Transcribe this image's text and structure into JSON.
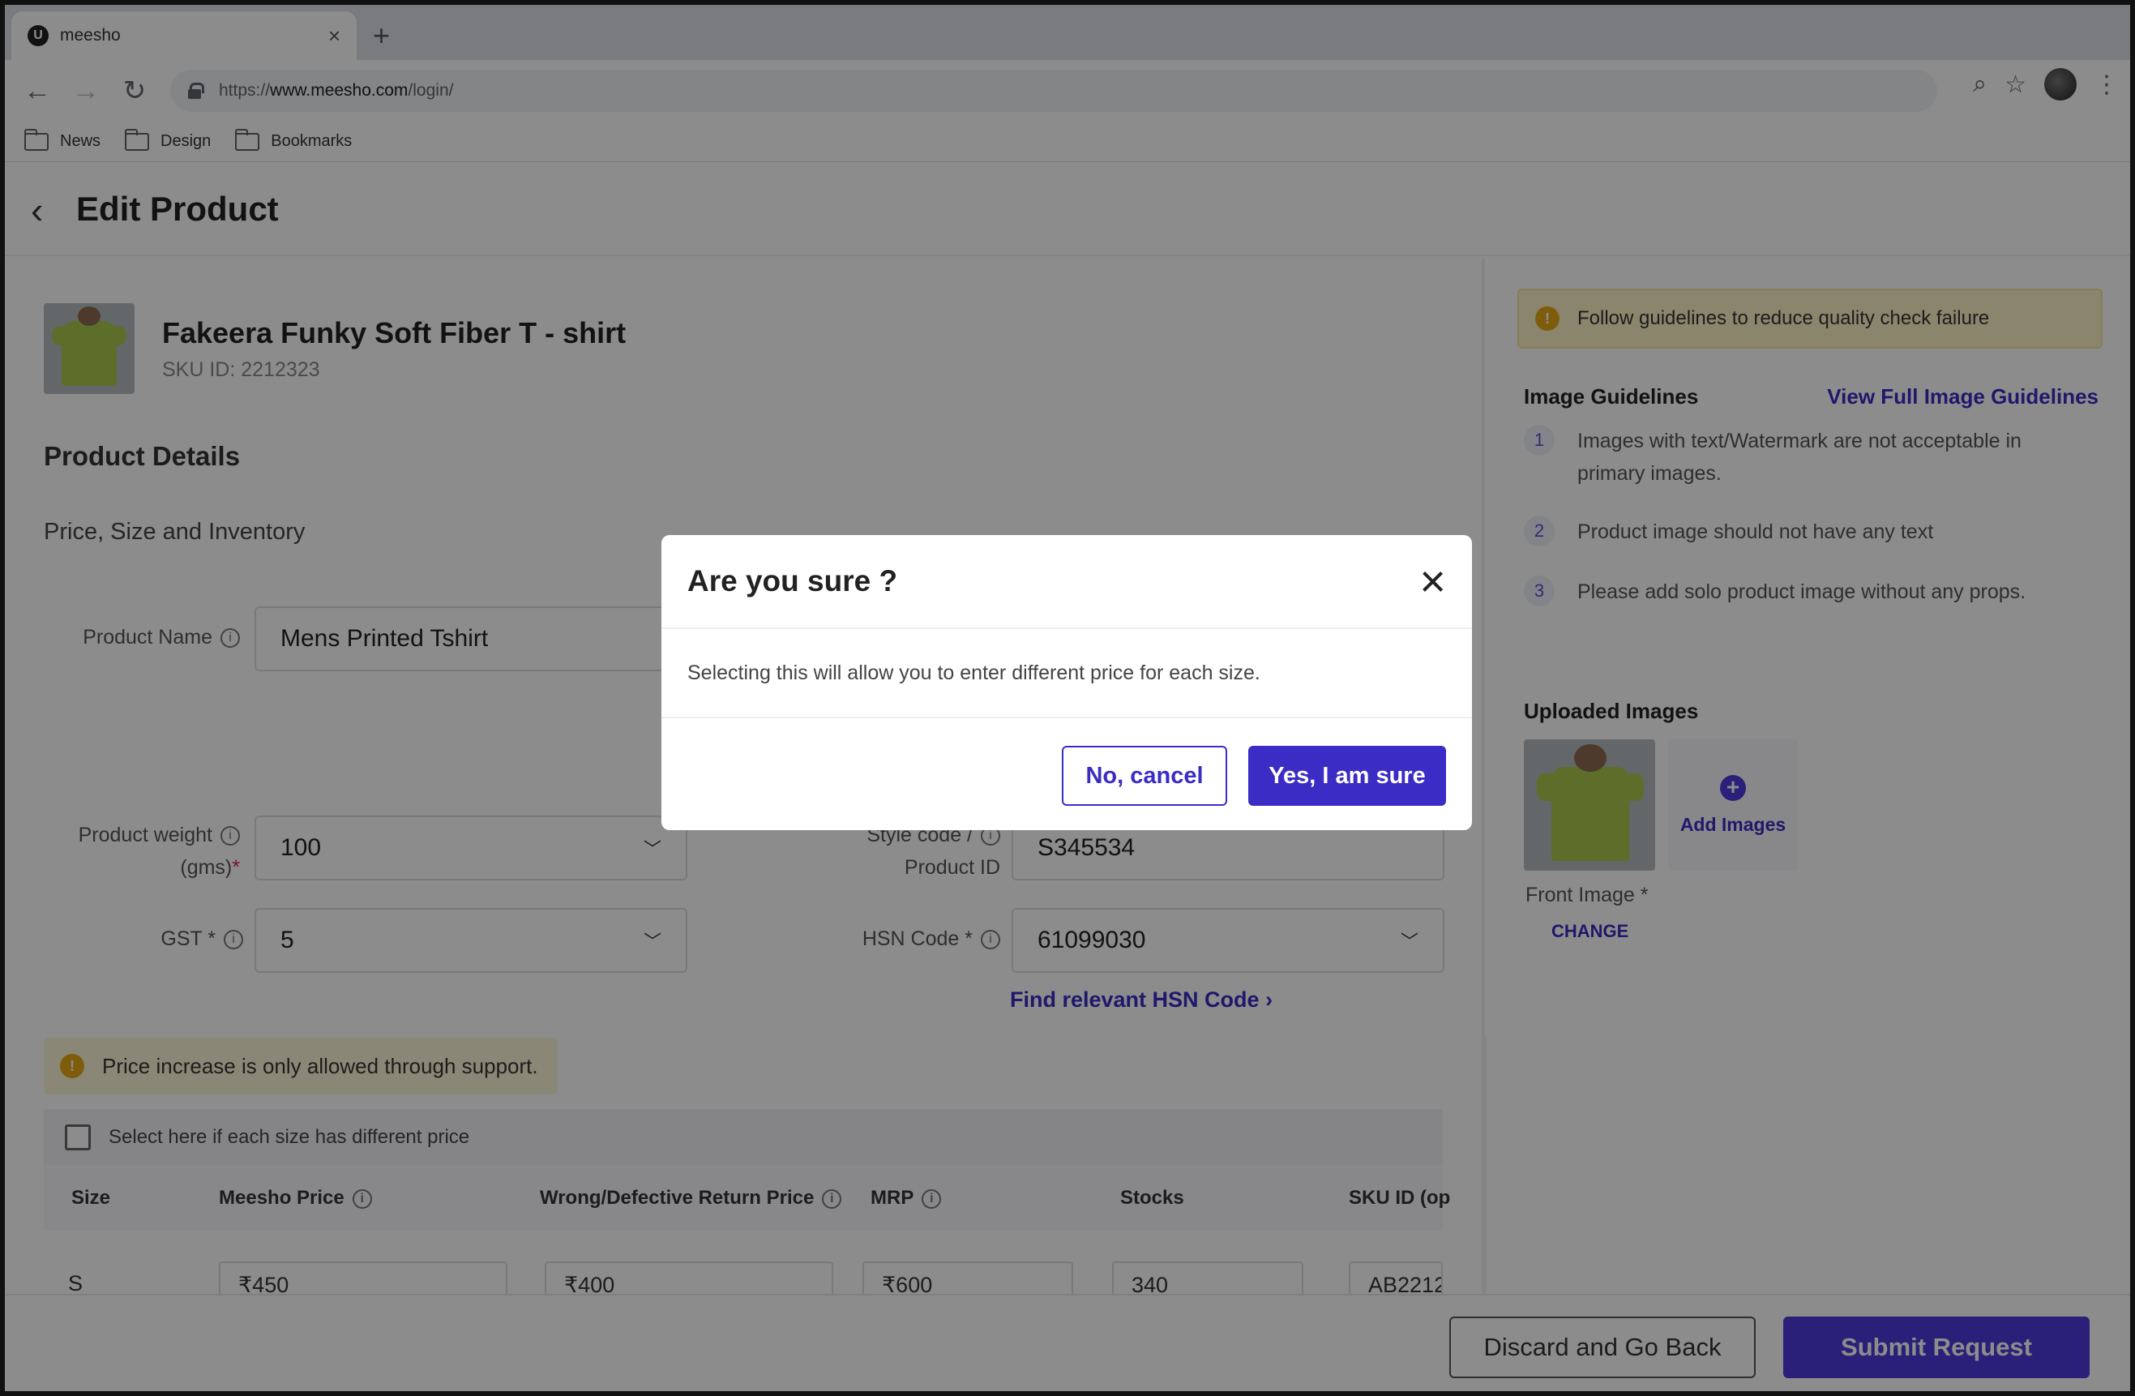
{
  "browser": {
    "tab_title": "meesho",
    "tab_favicon": "U",
    "url_scheme": "https://",
    "url_host": "www.meesho.com",
    "url_path": "/login/",
    "bookmarks": [
      "News",
      "Design",
      "Bookmarks"
    ]
  },
  "page": {
    "title": "Edit Product"
  },
  "product": {
    "name": "Fakeera Funky Soft Fiber T - shirt",
    "sku": "SKU ID: 2212323"
  },
  "details": {
    "section_title": "Product Details",
    "subsection_title": "Price, Size and Inventory",
    "product_name_label": "Product Name",
    "product_name_value": "Mens Printed Tshirt",
    "weight_label_line1": "Product weight",
    "weight_label_line2": "(gms)",
    "weight_value": "100",
    "style_code_label_line1": "Style code /",
    "style_code_label_line2": "Product ID",
    "style_code_value": "S345534",
    "gst_label": "GST *",
    "gst_value": "5",
    "hsn_label": "HSN Code *",
    "hsn_value": "61099030",
    "hsn_link": "Find relevant HSN Code"
  },
  "price_warning": "Price increase is only allowed through support.",
  "table": {
    "checkbox_label": "Select here if each size has different price",
    "columns": [
      "Size",
      "Meesho Price",
      "Wrong/Defective Return Price",
      "MRP",
      "Stocks",
      "SKU ID (op"
    ],
    "row": {
      "size": "S",
      "meesho_price": "₹450",
      "return_price": "₹400",
      "mrp": "₹600",
      "stocks": "340",
      "sku": "AB2212"
    }
  },
  "guidelines": {
    "warning": "Follow guidelines to reduce quality check failure",
    "title": "Image Guidelines",
    "link": "View Full Image Guidelines",
    "items": [
      {
        "num": "1",
        "line1": "Images with text/Watermark are not acceptable in",
        "line2": "primary images."
      },
      {
        "num": "2",
        "line1": "Product image should not have any text"
      },
      {
        "num": "3",
        "line1": "Please add solo product image without any props."
      }
    ]
  },
  "uploads": {
    "title": "Uploaded Images",
    "add_label": "Add Images",
    "front_label": "Front Image *",
    "change_label": "CHANGE"
  },
  "footer": {
    "discard": "Discard and Go Back",
    "submit": "Submit Request"
  },
  "modal": {
    "title": "Are you sure ?",
    "body": "Selecting this will allow you to enter different price for each size.",
    "cancel": "No, cancel",
    "confirm": "Yes, I am sure"
  }
}
